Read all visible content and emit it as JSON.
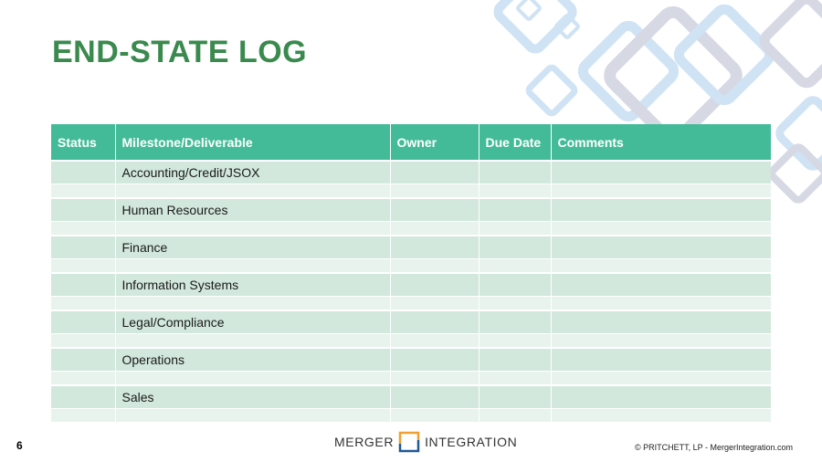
{
  "title": "END-STATE LOG",
  "table": {
    "headers": [
      "Status",
      "Milestone/Deliverable",
      "Owner",
      "Due Date",
      "Comments"
    ],
    "rows": [
      {
        "milestone": "Accounting/Credit/JSOX"
      },
      {
        "milestone": "Human Resources"
      },
      {
        "milestone": "Finance"
      },
      {
        "milestone": "Information Systems"
      },
      {
        "milestone": "Legal/Compliance"
      },
      {
        "milestone": "Operations"
      },
      {
        "milestone": "Sales"
      }
    ]
  },
  "footer": {
    "page_number": "6",
    "logo_left": "MERGER",
    "logo_right": "INTEGRATION",
    "copyright": "© PRITCHETT, LP  -  MergerIntegration.com"
  },
  "colors": {
    "title": "#3a8a4e",
    "header_bg": "#44bb98",
    "row_bg": "#d2e8dc",
    "spacer_bg": "#e8f3ed",
    "logo_orange": "#f0a030",
    "logo_blue": "#1f5a96"
  }
}
